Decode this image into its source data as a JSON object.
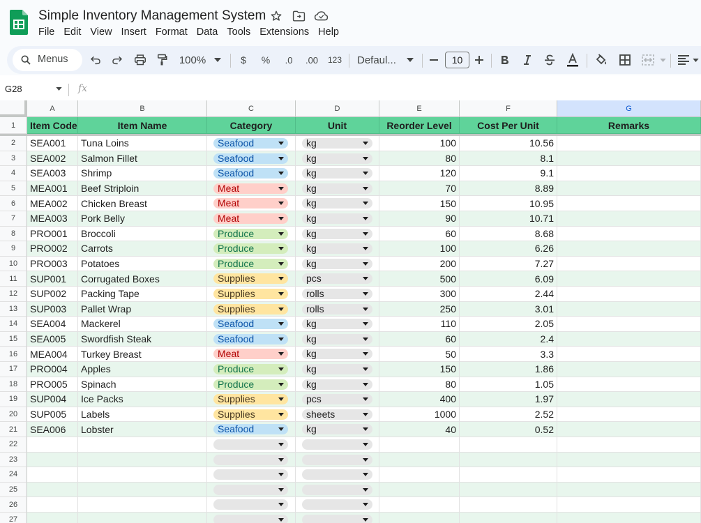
{
  "window": {
    "title": "Simple Inventory Management System",
    "menus": [
      "File",
      "Edit",
      "View",
      "Insert",
      "Format",
      "Data",
      "Tools",
      "Extensions",
      "Help"
    ]
  },
  "toolbar": {
    "search_label": "Menus",
    "zoom": "100%",
    "currency": "$",
    "percent": "%",
    "decimal_decrease": ".0",
    "decimal_increase": ".00",
    "number_format": "123",
    "font": "Defaul...",
    "font_size": "10"
  },
  "formula_bar": {
    "cell_ref": "G28",
    "fx": "fx",
    "value": ""
  },
  "grid": {
    "columns": [
      "A",
      "B",
      "C",
      "D",
      "E",
      "F",
      "G"
    ],
    "selected_column": "G",
    "headers": [
      "Item Code",
      "Item Name",
      "Category",
      "Unit",
      "Reorder Level",
      "Cost Per Unit",
      "Remarks"
    ],
    "rows": [
      {
        "n": "2",
        "code": "SEA001",
        "name": "Tuna Loins",
        "category": "Seafood",
        "unit": "kg",
        "reorder": "100",
        "cost": "10.56"
      },
      {
        "n": "3",
        "code": "SEA002",
        "name": "Salmon Fillet",
        "category": "Seafood",
        "unit": "kg",
        "reorder": "80",
        "cost": "8.1"
      },
      {
        "n": "4",
        "code": "SEA003",
        "name": "Shrimp",
        "category": "Seafood",
        "unit": "kg",
        "reorder": "120",
        "cost": "9.1"
      },
      {
        "n": "5",
        "code": "MEA001",
        "name": "Beef Striploin",
        "category": "Meat",
        "unit": "kg",
        "reorder": "70",
        "cost": "8.89"
      },
      {
        "n": "6",
        "code": "MEA002",
        "name": "Chicken Breast",
        "category": "Meat",
        "unit": "kg",
        "reorder": "150",
        "cost": "10.95"
      },
      {
        "n": "7",
        "code": "MEA003",
        "name": "Pork Belly",
        "category": "Meat",
        "unit": "kg",
        "reorder": "90",
        "cost": "10.71"
      },
      {
        "n": "8",
        "code": "PRO001",
        "name": "Broccoli",
        "category": "Produce",
        "unit": "kg",
        "reorder": "60",
        "cost": "8.68"
      },
      {
        "n": "9",
        "code": "PRO002",
        "name": "Carrots",
        "category": "Produce",
        "unit": "kg",
        "reorder": "100",
        "cost": "6.26"
      },
      {
        "n": "10",
        "code": "PRO003",
        "name": "Potatoes",
        "category": "Produce",
        "unit": "kg",
        "reorder": "200",
        "cost": "7.27"
      },
      {
        "n": "11",
        "code": "SUP001",
        "name": "Corrugated Boxes",
        "category": "Supplies",
        "unit": "pcs",
        "reorder": "500",
        "cost": "6.09"
      },
      {
        "n": "12",
        "code": "SUP002",
        "name": "Packing Tape",
        "category": "Supplies",
        "unit": "rolls",
        "reorder": "300",
        "cost": "2.44"
      },
      {
        "n": "13",
        "code": "SUP003",
        "name": "Pallet Wrap",
        "category": "Supplies",
        "unit": "rolls",
        "reorder": "250",
        "cost": "3.01"
      },
      {
        "n": "14",
        "code": "SEA004",
        "name": "Mackerel",
        "category": "Seafood",
        "unit": "kg",
        "reorder": "110",
        "cost": "2.05"
      },
      {
        "n": "15",
        "code": "SEA005",
        "name": "Swordfish Steak",
        "category": "Seafood",
        "unit": "kg",
        "reorder": "60",
        "cost": "2.4"
      },
      {
        "n": "16",
        "code": "MEA004",
        "name": "Turkey Breast",
        "category": "Meat",
        "unit": "kg",
        "reorder": "50",
        "cost": "3.3"
      },
      {
        "n": "17",
        "code": "PRO004",
        "name": "Apples",
        "category": "Produce",
        "unit": "kg",
        "reorder": "150",
        "cost": "1.86"
      },
      {
        "n": "18",
        "code": "PRO005",
        "name": "Spinach",
        "category": "Produce",
        "unit": "kg",
        "reorder": "80",
        "cost": "1.05"
      },
      {
        "n": "19",
        "code": "SUP004",
        "name": "Ice Packs",
        "category": "Supplies",
        "unit": "pcs",
        "reorder": "400",
        "cost": "1.97"
      },
      {
        "n": "20",
        "code": "SUP005",
        "name": "Labels",
        "category": "Supplies",
        "unit": "sheets",
        "reorder": "1000",
        "cost": "2.52"
      },
      {
        "n": "21",
        "code": "SEA006",
        "name": "Lobster",
        "category": "Seafood",
        "unit": "kg",
        "reorder": "40",
        "cost": "0.52"
      }
    ],
    "empty_rows": [
      "22",
      "23",
      "24",
      "25",
      "26",
      "27"
    ]
  },
  "category_colors": {
    "Seafood": "#bfe1f6",
    "Meat": "#ffcfc9",
    "Produce": "#d4edbc",
    "Supplies": "#ffe5a0"
  },
  "theme": {
    "header_green": "#5fd39a",
    "band_green": "#e8f6ed",
    "logo_green": "#0f9d58"
  }
}
